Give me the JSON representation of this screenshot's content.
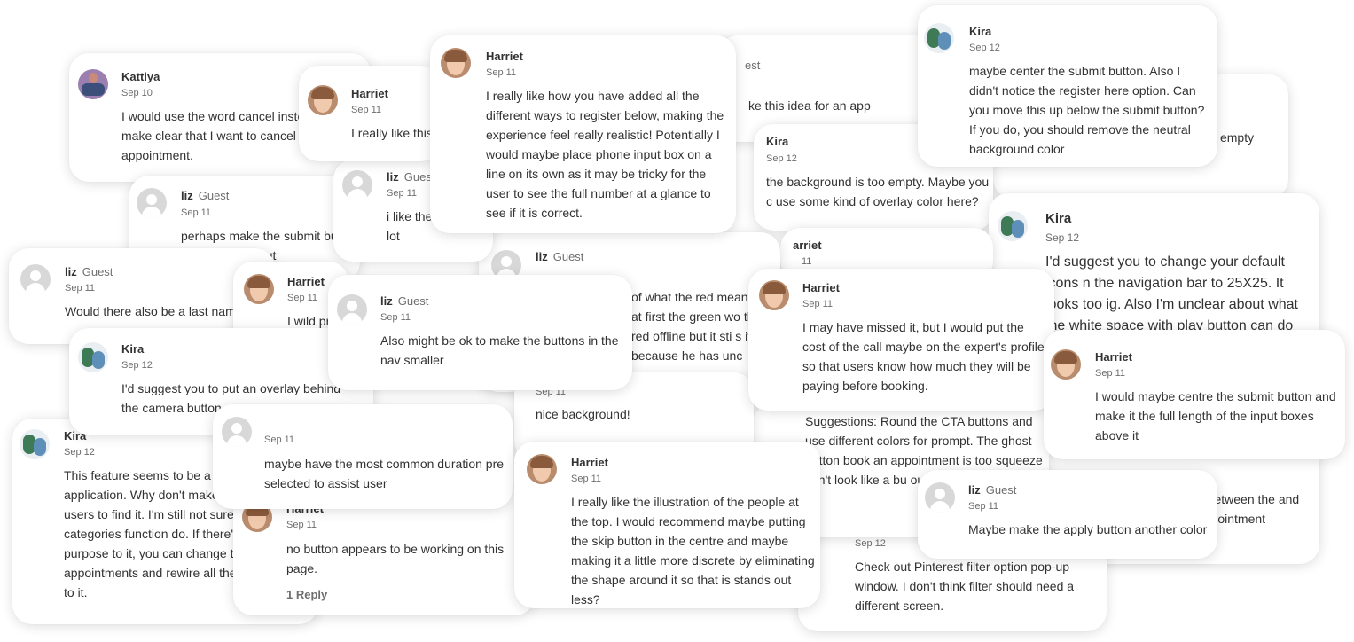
{
  "comments": [
    {
      "author": "Kattiya",
      "role": "",
      "date": "Sep 10",
      "text": "I would use the word cancel instead of to make clear that I want to cancel my appointment.",
      "avatar": "kattiya-avatar"
    },
    {
      "author": "liz",
      "role": "Guest",
      "date": "Sep 11",
      "text": "perhaps make the submit button color to stand out",
      "avatar": "guest-avatar"
    },
    {
      "author": "Harriet",
      "role": "",
      "date": "Sep 11",
      "text": "I really like this",
      "avatar": "harriet-avatar"
    },
    {
      "author": "liz",
      "role": "Guest",
      "date": "Sep 11",
      "text": "i like the lot",
      "avatar": "guest-avatar"
    },
    {
      "author": "Harriet",
      "role": "",
      "date": "Sep 11",
      "text": "I really like how you have added all the different ways to register below, making the experience feel really realistic! Potentially I would maybe place phone input box on a line on its own as it may be tricky for the user to see the full number at a glance to see if it is correct.",
      "avatar": "harriet-avatar"
    },
    {
      "author": "",
      "role": "est",
      "date": "",
      "text": "ke this idea for an app",
      "avatar": ""
    },
    {
      "author": "Kira",
      "role": "",
      "date": "Sep 12",
      "text": "the background is too empty. Maybe you c use some kind of overlay color here?",
      "avatar": ""
    },
    {
      "author": "Kira",
      "role": "",
      "date": "Sep 12",
      "text": "maybe center the submit button. Also I didn't notice the register here option.  Can you move this up below the submit button? If you do, you should remove the neutral background color",
      "avatar": "kira-avatar"
    },
    {
      "author": "",
      "role": "",
      "date": "",
      "text": "d with a ndow is white?. It looks empty here",
      "avatar": ""
    },
    {
      "author": "Kira",
      "role": "",
      "date": "Sep 12",
      "text": "I'd suggest you to change your default icons n the navigation bar to 25X25. It looks too ig.  Also I'm unclear about what the white space with play button can do",
      "avatar": "kira-avatar"
    },
    {
      "author": "liz",
      "role": "Guest",
      "date": "Sep 11",
      "text": "Would there also be a last name",
      "avatar": "guest-avatar"
    },
    {
      "author": "Harriet",
      "role": "",
      "date": "Sep 11",
      "text": "I wild pr",
      "avatar": "harriet-avatar"
    },
    {
      "author": "liz",
      "role": "Guest",
      "date": "Sep 11",
      "text": "of what the red means ht at first the green wo the red offline but it sti s it because he has unc",
      "avatar": "guest-avatar"
    },
    {
      "author": "liz",
      "role": "Guest",
      "date": "Sep 11",
      "text": "Also might be ok to make the buttons in the nav smaller",
      "avatar": "guest-avatar"
    },
    {
      "author": "arriet",
      "role": "",
      "date": "11",
      "text": "",
      "avatar": ""
    },
    {
      "author": "Harriet",
      "role": "",
      "date": "Sep 11",
      "text": "I may have missed it, but I would put the cost of the call maybe on the expert's profile so that users know how much they will be paying before booking.",
      "avatar": "harriet-avatar"
    },
    {
      "author": "Harriet",
      "role": "",
      "date": "Sep 11",
      "text": "I would maybe centre the submit button and make it the full length of the input boxes above it",
      "avatar": "harriet-avatar"
    },
    {
      "author": "Kira",
      "role": "",
      "date": "Sep 12",
      "text": "I'd suggest you to put an overlay behind the camera button",
      "avatar": "kira-avatar"
    },
    {
      "author": "",
      "role": "",
      "date": "Sep 11",
      "text": "nice background!",
      "avatar": ""
    },
    {
      "author": "",
      "role": "",
      "date": "",
      "text": "Suggestions: Round the CTA buttons and use different colors for prompt. The ghost button book an appointment is too squeeze esn't look like a bu ould just call it \"Bo or.",
      "avatar": ""
    },
    {
      "author": "Kira",
      "role": "",
      "date": "Sep 12",
      "text": "This feature seems to be a ke application. Why don't make users to find it. I'm still not sure categories function do. If there's purpose to it, you can change th appointments and rewire all the to it.",
      "avatar": "kira-avatar"
    },
    {
      "author": "",
      "role": "",
      "date": "Sep 11",
      "text": "maybe have the most common duration  pre selected to assist user",
      "avatar": "guest-avatar"
    },
    {
      "author": "Harriet",
      "role": "",
      "date": "Sep 11",
      "text": "no button appears to be working on this page.",
      "reply": "1 Reply",
      "avatar": "harriet-avatar"
    },
    {
      "author": "Harriet",
      "role": "",
      "date": "Sep 11",
      "text": "I really like the illustration of the people at the top. I would recommend maybe putting the skip button in the centre and  maybe making it a little more discrete by eliminating the shape around it so that is stands out less?",
      "avatar": "harriet-avatar"
    },
    {
      "author": "",
      "role": "",
      "date": "Sep 12",
      "text": "Check out Pinterest filter option pop-up window. I don't think filter should need a different screen.",
      "avatar": ""
    },
    {
      "author": "",
      "role": "",
      "date": "",
      "text": "e between the and appointment",
      "avatar": ""
    },
    {
      "author": "liz",
      "role": "Guest",
      "date": "Sep 11",
      "text": "Maybe make the apply button another color",
      "avatar": "guest-avatar"
    }
  ]
}
